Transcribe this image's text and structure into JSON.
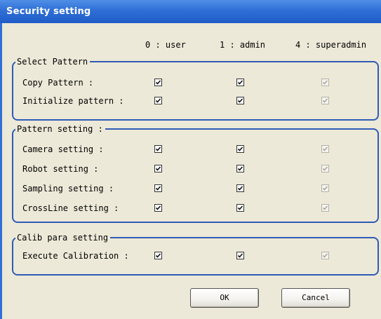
{
  "window": {
    "title": "Security setting"
  },
  "columns": [
    "0 : user",
    "1 : admin",
    "4 : superadmin"
  ],
  "groups": [
    {
      "legend": "Select Pattern",
      "rows": [
        {
          "label": "Copy Pattern :",
          "checked": [
            true,
            true,
            true
          ],
          "enabled": [
            true,
            true,
            false
          ]
        },
        {
          "label": "Initialize pattern :",
          "checked": [
            true,
            true,
            true
          ],
          "enabled": [
            true,
            true,
            false
          ]
        }
      ]
    },
    {
      "legend": "Pattern setting :",
      "rows": [
        {
          "label": "Camera setting :",
          "checked": [
            true,
            true,
            true
          ],
          "enabled": [
            true,
            true,
            false
          ]
        },
        {
          "label": "Robot setting :",
          "checked": [
            true,
            true,
            true
          ],
          "enabled": [
            true,
            true,
            false
          ]
        },
        {
          "label": "Sampling setting :",
          "checked": [
            true,
            true,
            true
          ],
          "enabled": [
            true,
            true,
            false
          ]
        },
        {
          "label": "CrossLine setting :",
          "checked": [
            true,
            true,
            true
          ],
          "enabled": [
            true,
            true,
            false
          ]
        }
      ]
    },
    {
      "legend": "Calib para setting",
      "rows": [
        {
          "label": "Execute Calibration :",
          "checked": [
            true,
            true,
            true
          ],
          "enabled": [
            true,
            true,
            false
          ]
        }
      ]
    }
  ],
  "buttons": {
    "ok": "OK",
    "cancel": "Cancel"
  },
  "colors": {
    "titlebar": "#2f6fd6",
    "group_border": "#2f5bb5",
    "background": "#ece9d8"
  }
}
